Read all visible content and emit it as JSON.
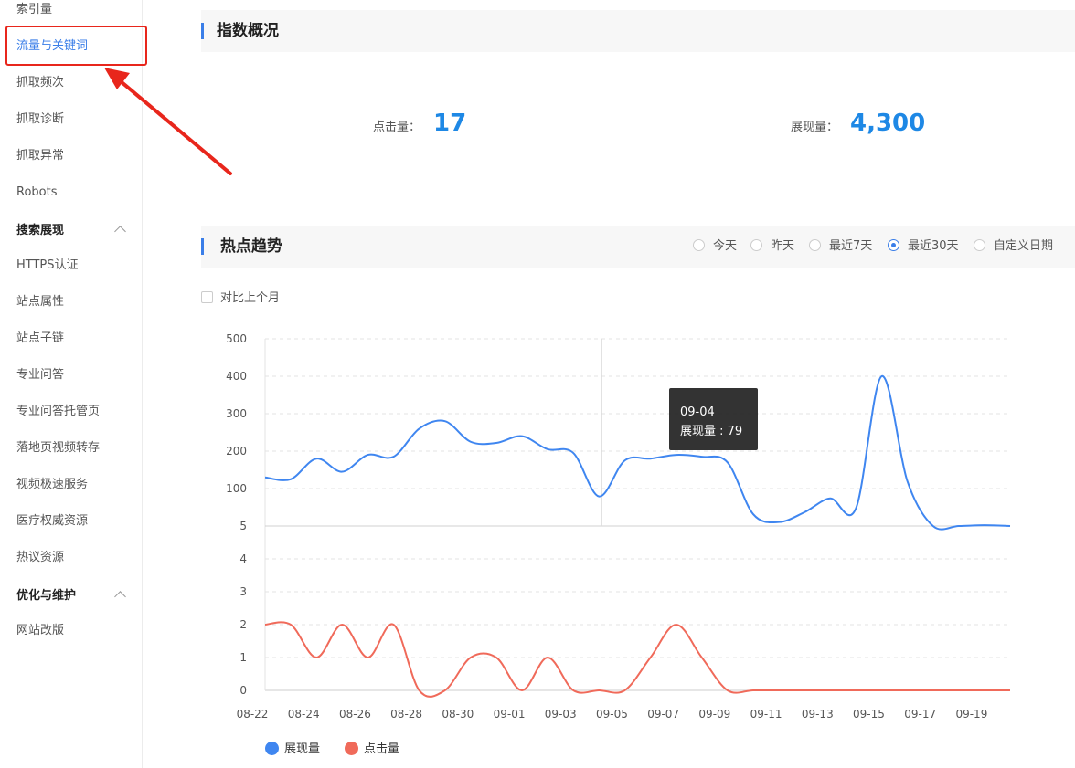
{
  "sidebar": {
    "items": [
      {
        "label": "索引量"
      },
      {
        "label": "流量与关键词"
      },
      {
        "label": "抓取频次"
      },
      {
        "label": "抓取诊断"
      },
      {
        "label": "抓取异常"
      },
      {
        "label": "Robots"
      },
      {
        "label": "HTTPS认证"
      },
      {
        "label": "站点属性"
      },
      {
        "label": "站点子链"
      },
      {
        "label": "专业问答"
      },
      {
        "label": "专业问答托管页"
      },
      {
        "label": "落地页视频转存"
      },
      {
        "label": "视频极速服务"
      },
      {
        "label": "医疗权威资源"
      },
      {
        "label": "热议资源"
      },
      {
        "label": "网站改版"
      }
    ],
    "groups": [
      {
        "label": "搜索展现"
      },
      {
        "label": "优化与维护"
      }
    ]
  },
  "overview": {
    "title": "指数概况",
    "clicks_label": "点击量：",
    "clicks_value": "17",
    "impressions_label": "展现量：",
    "impressions_value": "4,300"
  },
  "trend": {
    "title": "热点趋势",
    "ranges": [
      {
        "label": "今天"
      },
      {
        "label": "昨天"
      },
      {
        "label": "最近7天"
      },
      {
        "label": "最近30天",
        "checked": true
      },
      {
        "label": "自定义日期"
      }
    ],
    "compare_label": "对比上个月",
    "tooltip": {
      "date": "09-04",
      "text": "展现量 : 79"
    }
  },
  "colors": {
    "accent": "#3a7ee8",
    "impressions": "#3f86f0",
    "clicks": "#f06a5a",
    "highlight": "#e8261c"
  },
  "chart_data": {
    "type": "line",
    "x": [
      "08-22",
      "08-23",
      "08-24",
      "08-25",
      "08-26",
      "08-27",
      "08-28",
      "08-29",
      "08-30",
      "08-31",
      "09-01",
      "09-02",
      "09-03",
      "09-04",
      "09-05",
      "09-06",
      "09-07",
      "09-08",
      "09-09",
      "09-10",
      "09-11",
      "09-12",
      "09-13",
      "09-14",
      "09-15",
      "09-16",
      "09-17",
      "09-18",
      "09-19",
      "09-20"
    ],
    "x_tick_labels": [
      "08-22",
      "08-24",
      "08-26",
      "08-28",
      "08-30",
      "09-01",
      "09-03",
      "09-05",
      "09-07",
      "09-09",
      "09-11",
      "09-13",
      "09-15",
      "09-17",
      "09-19"
    ],
    "upper_axis_ticks": [
      "500",
      "400",
      "300",
      "200",
      "100",
      "5"
    ],
    "lower_axis_ticks": [
      "5",
      "4",
      "3",
      "2",
      "1",
      "0"
    ],
    "series": [
      {
        "name": "展现量",
        "values": [
          130,
          125,
          180,
          145,
          190,
          185,
          260,
          280,
          225,
          222,
          240,
          205,
          195,
          80,
          175,
          180,
          190,
          185,
          170,
          35,
          15,
          40,
          75,
          50,
          400,
          120,
          5,
          5,
          7,
          5
        ]
      },
      {
        "name": "点击量",
        "values": [
          2,
          2,
          1,
          2,
          1,
          2,
          0,
          0,
          1,
          1,
          0,
          1,
          0,
          0,
          0,
          1,
          2,
          1,
          0,
          0,
          0,
          0,
          0,
          0,
          0,
          0,
          0,
          0,
          0,
          0
        ]
      }
    ]
  }
}
